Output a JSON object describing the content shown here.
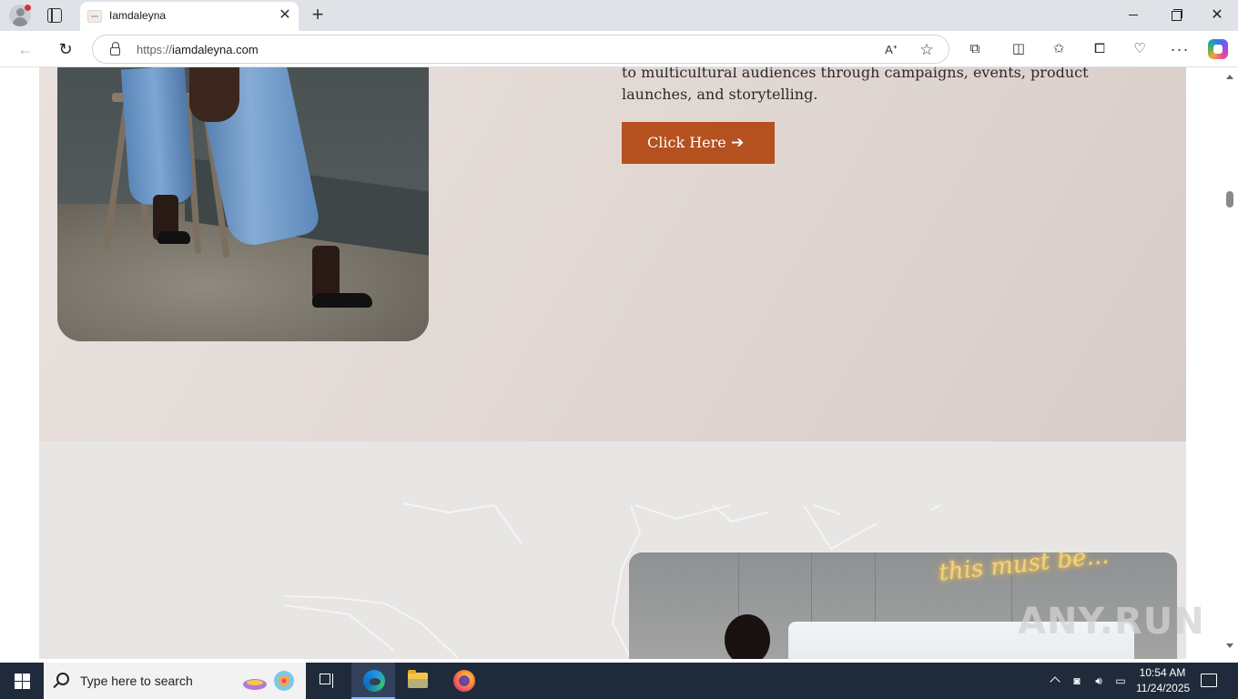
{
  "browser": {
    "tab": {
      "title": "Iamdaleyna"
    },
    "address": {
      "scheme": "https://",
      "host": "iamdaleyna.com"
    }
  },
  "page": {
    "hero": {
      "text_line1": "to multicultural audiences through campaigns, events, product",
      "text_line2": "launches, and storytelling.",
      "cta_label": "Click Here",
      "cta_color": "#b5501f"
    },
    "photo_two": {
      "neon_text": "this must be..."
    },
    "watermark": "ANY.RUN"
  },
  "taskbar": {
    "search_placeholder": "Type here to search",
    "clock_time": "10:54 AM",
    "clock_date": "11/24/2025"
  },
  "icons": {
    "tabbar": [
      "profile-icon",
      "tab-actions-icon",
      "close-icon",
      "new-tab-icon",
      "minimize-icon",
      "maximize-icon",
      "window-close-icon"
    ],
    "toolbar": [
      "back-icon",
      "refresh-icon",
      "lock-icon",
      "read-aloud-icon",
      "favorite-star-icon",
      "extensions-icon",
      "split-screen-icon",
      "favorites-icon",
      "collections-icon",
      "performance-icon",
      "more-icon",
      "copilot-icon"
    ],
    "taskbar": [
      "windows-start-icon",
      "search-icon",
      "task-view-icon",
      "edge-icon",
      "file-explorer-icon",
      "firefox-icon",
      "show-hidden-icons-icon",
      "meet-now-icon",
      "volume-icon",
      "network-icon",
      "notifications-icon"
    ]
  }
}
